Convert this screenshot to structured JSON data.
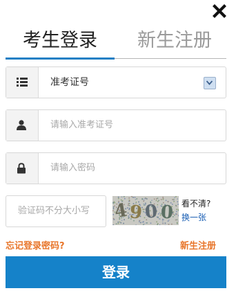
{
  "close": {
    "icon": "close-icon"
  },
  "tabs": [
    {
      "label": "考生登录",
      "active": true
    },
    {
      "label": "新生注册",
      "active": false
    }
  ],
  "id_type": {
    "icon": "list-icon",
    "value": "准考证号",
    "arrow_icon": "chevron-down-icon"
  },
  "username": {
    "icon": "user-icon",
    "placeholder": "请输入准考证号"
  },
  "password": {
    "icon": "lock-icon",
    "placeholder": "请输入密码"
  },
  "captcha": {
    "placeholder": "验证码不分大小写",
    "code": "4900",
    "unclear_text": "看不清?",
    "refresh_text": "换一张"
  },
  "links": {
    "forgot": "忘记登录密码?",
    "register": "新生注册"
  },
  "login_button": "登录",
  "colors": {
    "accent": "#1582c9",
    "link_orange": "#e8762b",
    "tab_underline": "#1e7fc4"
  }
}
